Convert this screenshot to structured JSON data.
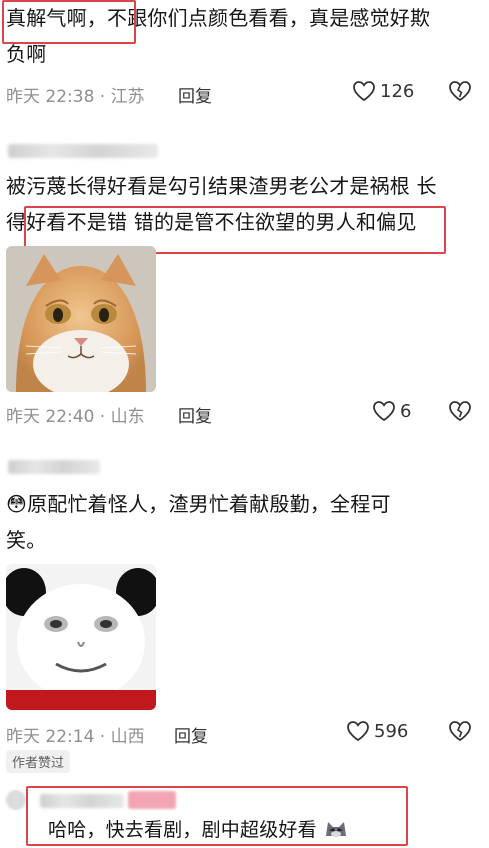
{
  "comments": [
    {
      "text_line1": "真解气啊，不跟你们点颜色看看，真是感觉好欺",
      "text_line2": "负啊",
      "time": "昨天 22:38",
      "location": "江苏",
      "reply_label": "回复",
      "likes": "126"
    },
    {
      "text_line1": "被污蔑长得好看是勾引结果渣男老公才是祸根 长",
      "text_line2": "得好看不是错 错的是管不住欲望的男人和偏见",
      "time": "昨天 22:40",
      "location": "山东",
      "reply_label": "回复",
      "likes": "6"
    },
    {
      "text_line1": "原配忙着怪人，渣男忙着献殷勤，全程可",
      "text_line2": "笑。",
      "emoji": "😳",
      "time": "昨天 22:14",
      "location": "山西",
      "reply_label": "回复",
      "likes": "596",
      "badge": "作者赞过"
    },
    {
      "text_line1": "哈哈，快去看剧，剧中超级好看"
    }
  ],
  "colors": {
    "highlight_box": "#d9454a",
    "meta_text": "#8f8f8f"
  },
  "icons": {
    "like": "heart-outline-icon",
    "dislike": "broken-heart-icon"
  }
}
